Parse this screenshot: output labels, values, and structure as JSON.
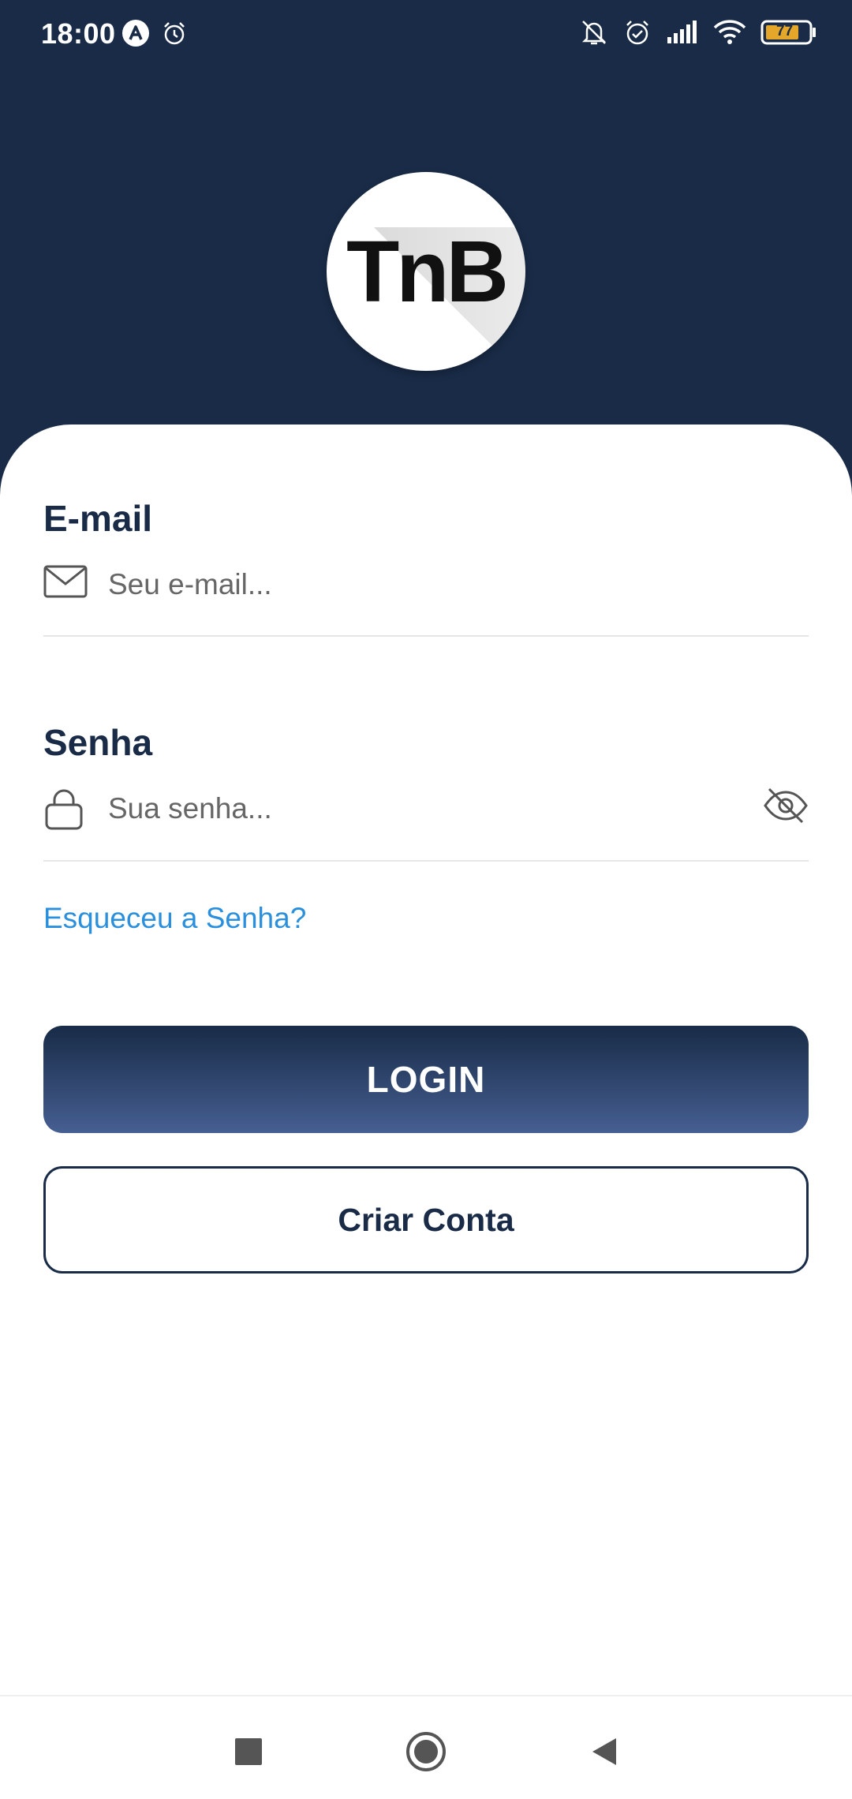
{
  "status_bar": {
    "time": "18:00",
    "battery_level": "77",
    "left_icons": [
      "app-a-icon",
      "alarm-icon"
    ],
    "right_icons": [
      "bell-off-icon",
      "alarm-icon",
      "signal-icon",
      "wifi-icon",
      "battery-icon"
    ]
  },
  "logo": {
    "text": "TnB"
  },
  "form": {
    "email": {
      "label": "E-mail",
      "placeholder": "Seu e-mail...",
      "value": "",
      "icon": "mail-icon"
    },
    "password": {
      "label": "Senha",
      "placeholder": "Sua senha...",
      "value": "",
      "icon": "lock-icon",
      "toggle_icon": "eye-off-icon"
    },
    "forgot_password": "Esqueceu a Senha?",
    "login_button": "LOGIN",
    "create_account_button": "Criar Conta"
  },
  "colors": {
    "header_bg": "#192b47",
    "primary": "#192b47",
    "link": "#2a8fdc",
    "button_gradient_end": "#465f92"
  },
  "nav_bar": {
    "buttons": [
      "recents-square-icon",
      "home-circle-icon",
      "back-triangle-icon"
    ]
  }
}
